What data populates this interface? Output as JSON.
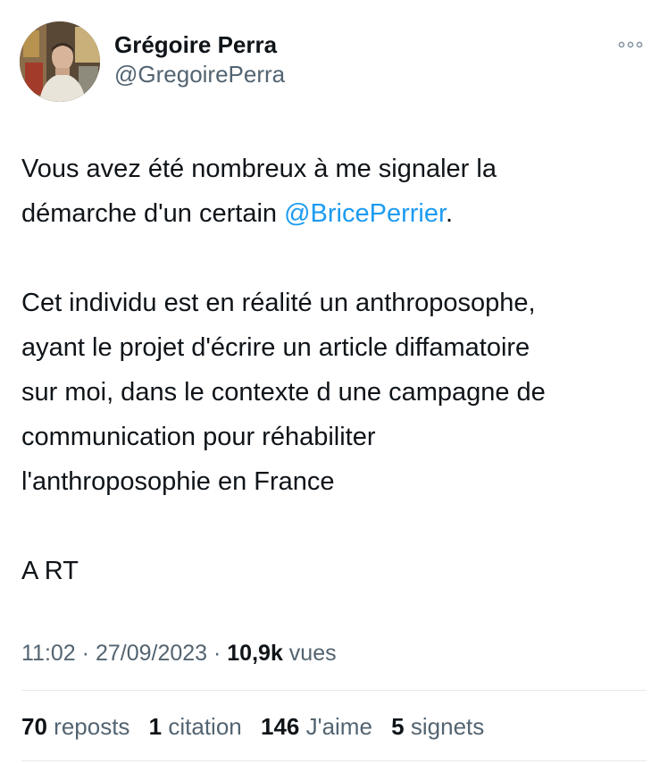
{
  "author": {
    "display_name": "Grégoire Perra",
    "handle": "@GregoirePerra"
  },
  "icons": {
    "more": "more-horizontal-icon",
    "avatar": "profile-photo"
  },
  "colors": {
    "text": "#0f1419",
    "secondary": "#536471",
    "link": "#1d9bf0",
    "divider": "#e7e9ea"
  },
  "tweet": {
    "line1": "Vous avez été nombreux à me signaler la",
    "line2_prefix": "démarche d'un certain ",
    "mention": "@BricePerrier",
    "line2_suffix": ".",
    "para2": [
      "Cet individu est en réalité un anthroposophe,",
      "ayant le projet d'écrire un article diffamatoire",
      "sur moi, dans le contexte d une campagne de",
      "communication pour réhabiliter",
      "l'anthroposophie en France"
    ],
    "para3": "A RT"
  },
  "meta": {
    "time": "11:02",
    "sep1": " · ",
    "date": "27/09/2023",
    "sep2": " · ",
    "views_count": "10,9k",
    "views_label": " vues"
  },
  "stats": [
    {
      "count": "70",
      "label": "reposts"
    },
    {
      "count": "1",
      "label": "citation"
    },
    {
      "count": "146",
      "label": "J'aime"
    },
    {
      "count": "5",
      "label": "signets"
    }
  ]
}
